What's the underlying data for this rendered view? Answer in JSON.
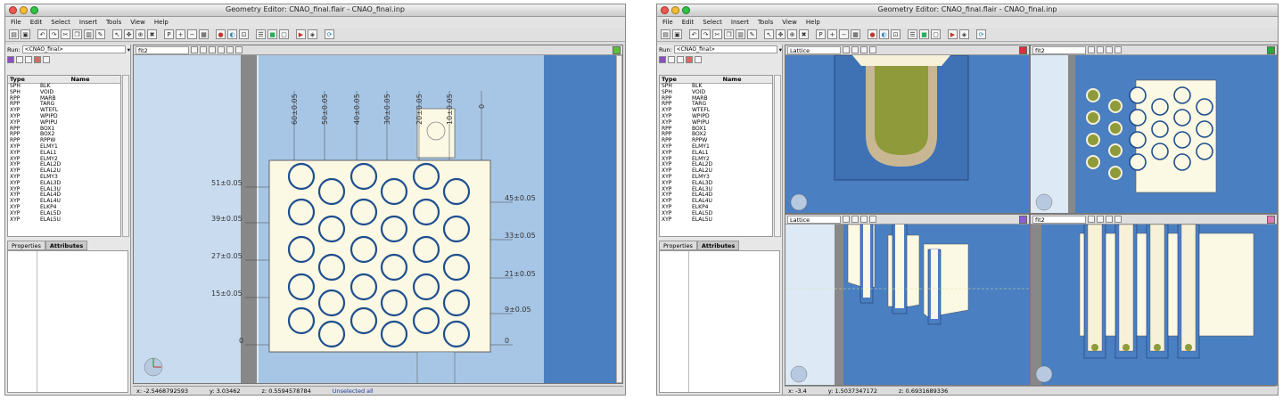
{
  "left_window": {
    "title": "Geometry Editor: CNAO_final.flair - CNAO_final.inp",
    "menu": [
      "File",
      "Edit",
      "Select",
      "Insert",
      "Tools",
      "View",
      "Help"
    ],
    "run_label": "Run:",
    "run_value": "<CNAO_final>",
    "table_headers": [
      "Type",
      "Name"
    ],
    "bodies": [
      [
        "SPH",
        "BLK"
      ],
      [
        "SPH",
        "VOID"
      ],
      [
        "RPP",
        "MARB"
      ],
      [
        "RPP",
        "TARG"
      ],
      [
        "XYP",
        "WTEFL"
      ],
      [
        "XYP",
        "WPIPD"
      ],
      [
        "XYP",
        "WPIPU"
      ],
      [
        "RPP",
        "BOX1"
      ],
      [
        "RPP",
        "BOX2"
      ],
      [
        "RPP",
        "RPPW"
      ],
      [
        "XYP",
        "ELMY1"
      ],
      [
        "XYP",
        "ELAL1"
      ],
      [
        "XYP",
        "ELMY2"
      ],
      [
        "XYP",
        "ELAL2D"
      ],
      [
        "XYP",
        "ELAL2U"
      ],
      [
        "XYP",
        "ELMY3"
      ],
      [
        "XYP",
        "ELAL3D"
      ],
      [
        "XYP",
        "ELAL3U"
      ],
      [
        "XYP",
        "ELAL4D"
      ],
      [
        "XYP",
        "ELAL4U"
      ],
      [
        "XYP",
        "ELKP4"
      ],
      [
        "XYP",
        "ELAL5D"
      ],
      [
        "XYP",
        "ELAL5U"
      ]
    ],
    "prop_tabs": [
      "Properties",
      "Attributes"
    ],
    "viewport_name": "fit2",
    "dim_labels_top": [
      "60±0.05",
      "50±0.05",
      "40±0.05",
      "30±0.05",
      "20±0.05",
      "10±0.05",
      "0"
    ],
    "dim_labels_left": [
      "51±0.05",
      "39±0.05",
      "27±0.05",
      "15±0.05",
      "0"
    ],
    "dim_labels_right": [
      "45±0.05",
      "33±0.05",
      "21±0.05",
      "9±0.05",
      "0"
    ],
    "status": {
      "x": "x:  -2.5468792593",
      "y": "y:  3.03462",
      "z": "z:  0.5594578784",
      "msg": "Unselected all"
    }
  },
  "right_window": {
    "title": "Geometry Editor: CNAO_final.flair - CNAO_final.inp",
    "menu": [
      "File",
      "Edit",
      "Select",
      "Insert",
      "Tools",
      "View",
      "Help"
    ],
    "run_label": "Run:",
    "run_value": "<CNAO_final>",
    "table_headers": [
      "Type",
      "Name"
    ],
    "bodies": [
      [
        "SPH",
        "BLK"
      ],
      [
        "SPH",
        "VOID"
      ],
      [
        "RPP",
        "MARB"
      ],
      [
        "RPP",
        "TARG"
      ],
      [
        "XYP",
        "WTEFL"
      ],
      [
        "XYP",
        "WPIPD"
      ],
      [
        "XYP",
        "WPIPU"
      ],
      [
        "RPP",
        "BOX1"
      ],
      [
        "RPP",
        "BOX2"
      ],
      [
        "RPP",
        "RPPW"
      ],
      [
        "XYP",
        "ELMY1"
      ],
      [
        "XYP",
        "ELAL1"
      ],
      [
        "XYP",
        "ELMY2"
      ],
      [
        "XYP",
        "ELAL2D"
      ],
      [
        "XYP",
        "ELAL2U"
      ],
      [
        "XYP",
        "ELMY3"
      ],
      [
        "XYP",
        "ELAL3D"
      ],
      [
        "XYP",
        "ELAL3U"
      ],
      [
        "XYP",
        "ELAL4D"
      ],
      [
        "XYP",
        "ELAL4U"
      ],
      [
        "XYP",
        "ELKP4"
      ],
      [
        "XYP",
        "ELAL5D"
      ],
      [
        "XYP",
        "ELAL5U"
      ]
    ],
    "prop_tabs": [
      "Properties",
      "Attributes"
    ],
    "viewports": [
      {
        "name": "Lattice",
        "corner_color": "#d9303c"
      },
      {
        "name": "fit2",
        "corner_color": "#2aa83a"
      },
      {
        "name": "Lattice",
        "corner_color": "#8a5fd6"
      },
      {
        "name": "fit2",
        "corner_color": "#e07bb5"
      }
    ],
    "status": {
      "x": "x:  -3.4",
      "y": "y:  1.5037347172",
      "z": "z:  0.6931689336"
    }
  },
  "colors": {
    "canvas_blue": "#4a7fc2",
    "canvas_light": "#a9c8e8",
    "block_fill": "#fbf8e3",
    "hole_ring": "#1f4f8f",
    "olive": "#8f9a3a",
    "tan": "#c9b794"
  }
}
